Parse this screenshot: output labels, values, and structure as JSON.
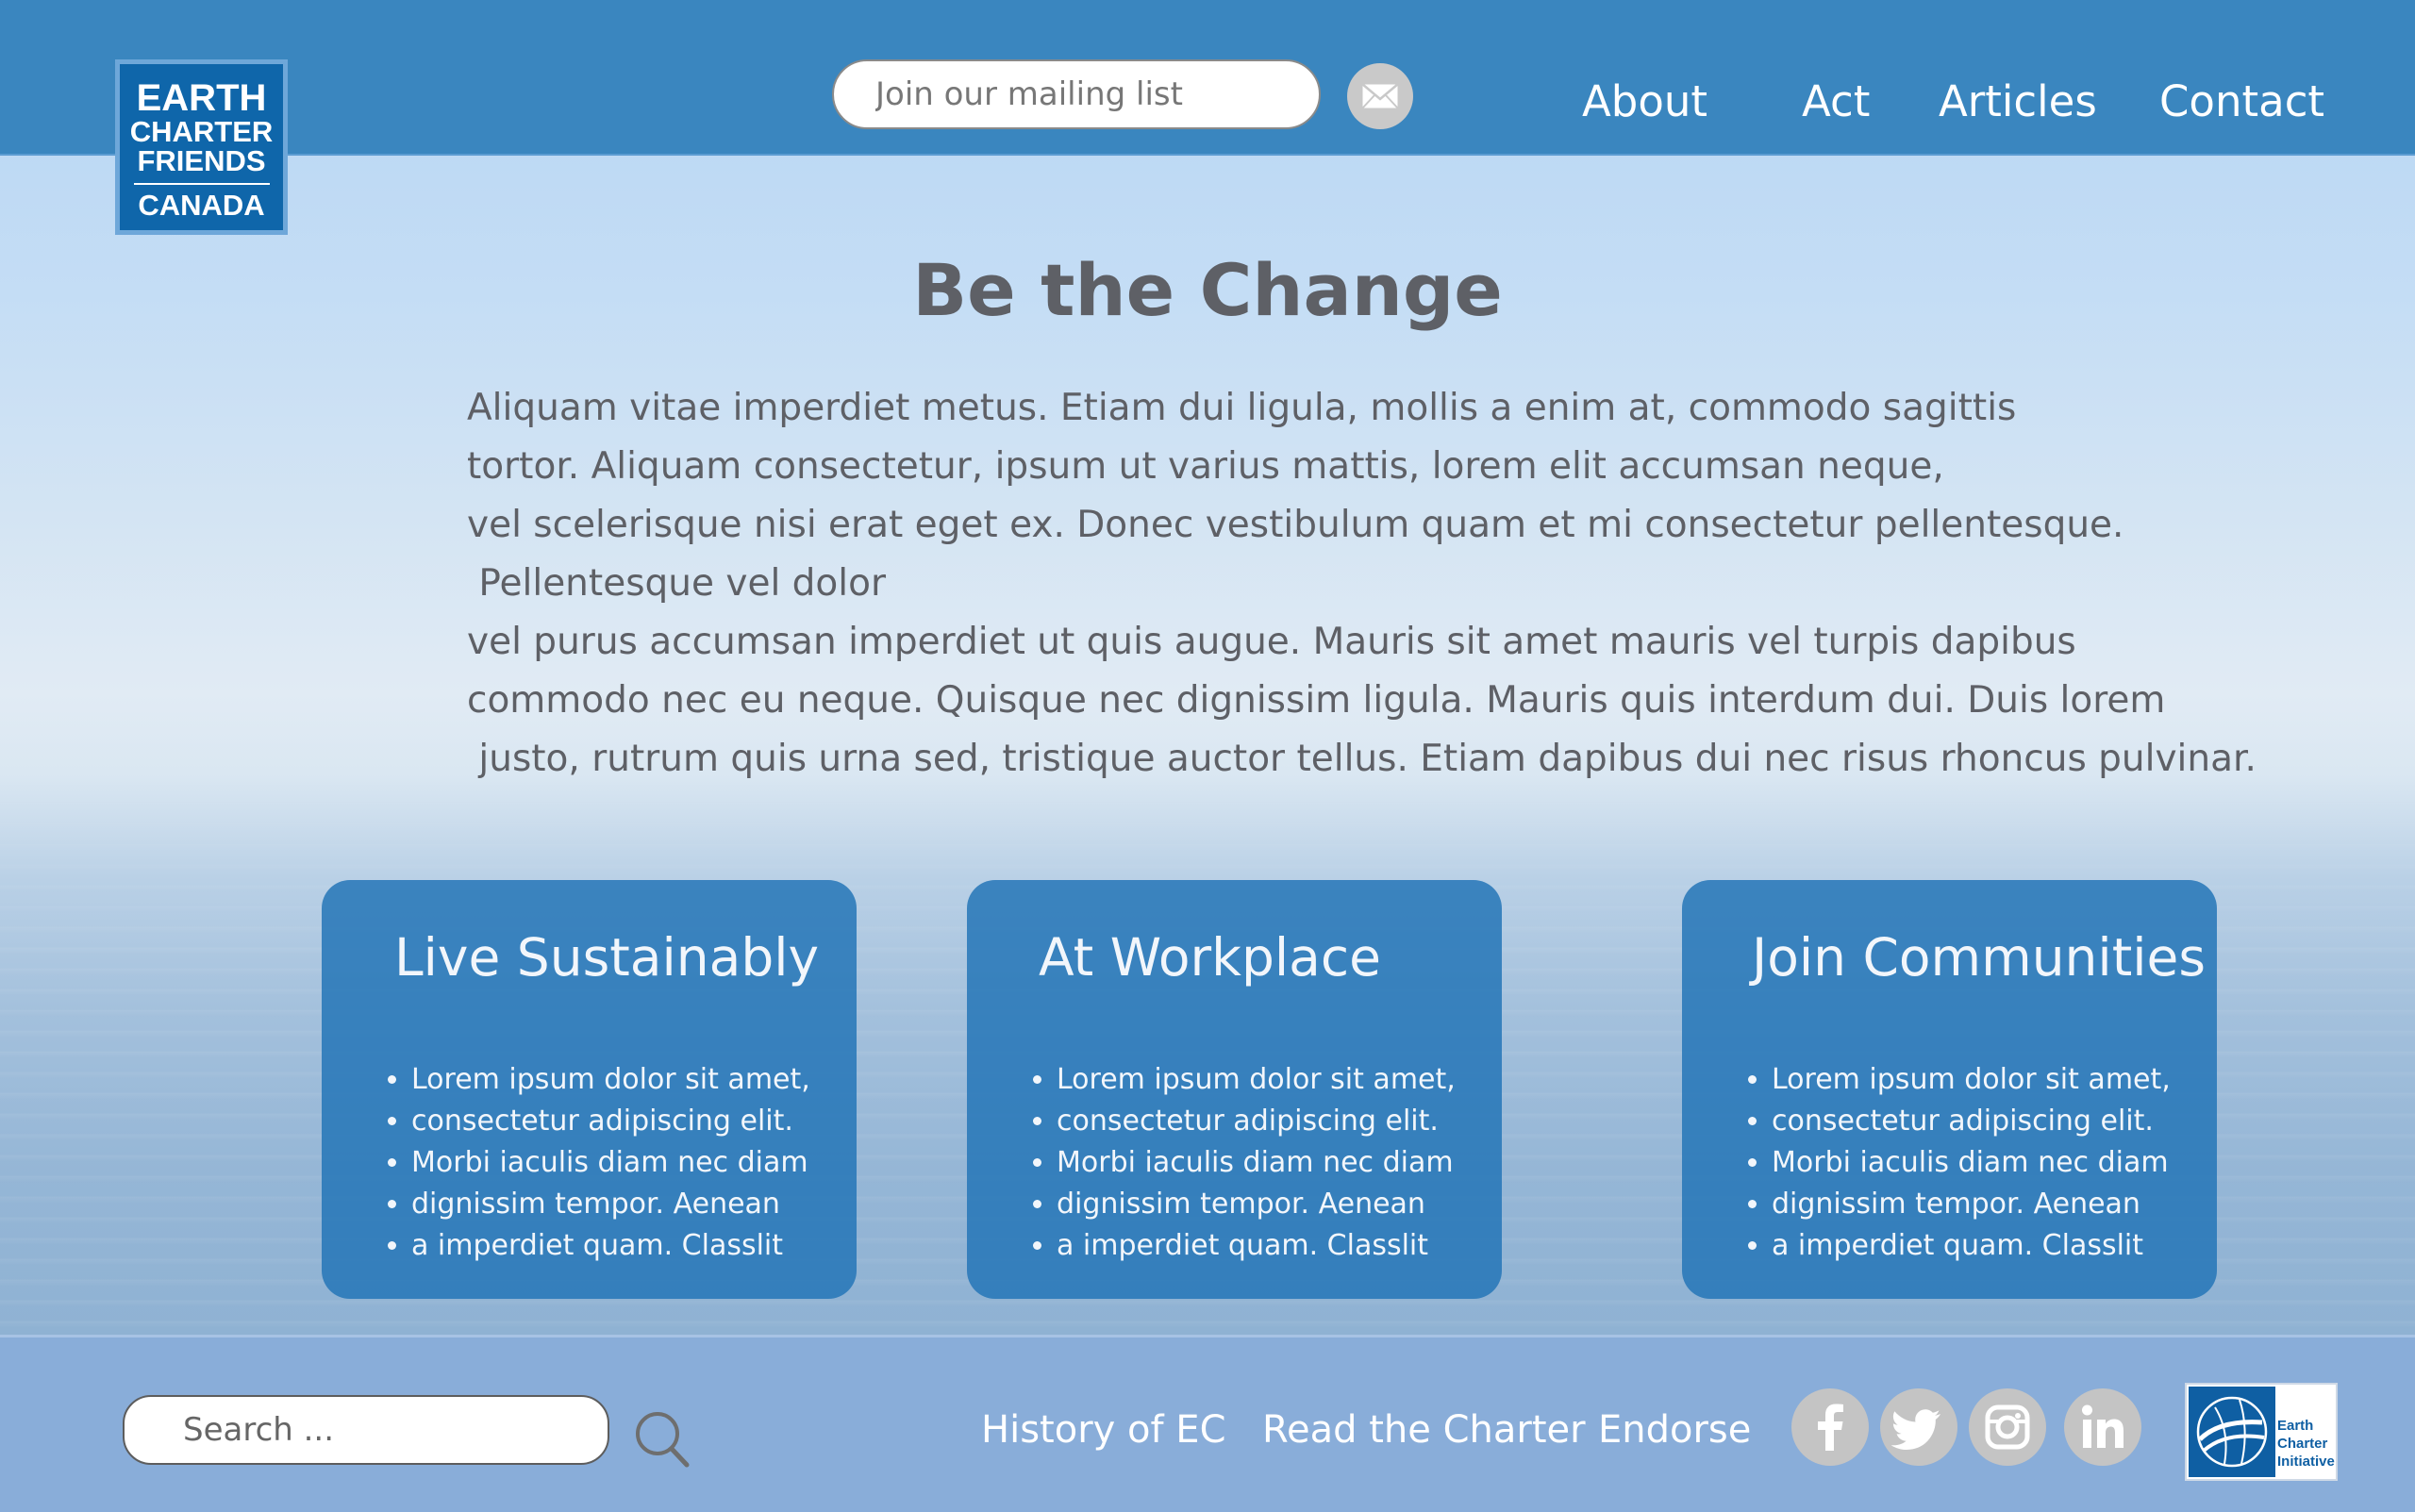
{
  "header": {
    "logo": {
      "line1": "EARTH",
      "line2": "CHARTER",
      "line3": "FRIENDS",
      "line4": "CANADA"
    },
    "mailing_list": {
      "placeholder": "Join our mailing list",
      "icon": "envelope-icon"
    },
    "nav": [
      {
        "label": "About"
      },
      {
        "label": "Act"
      },
      {
        "label": "Articles"
      },
      {
        "label": "Contact"
      }
    ]
  },
  "main": {
    "title": "Be the Change",
    "intro_lines": [
      "Aliquam vitae imperdiet metus. Etiam dui ligula, mollis a enim at, commodo sagittis",
      "tortor. Aliquam consectetur, ipsum ut varius mattis, lorem elit accumsan neque,",
      "vel scelerisque nisi erat eget ex. Donec vestibulum quam et mi consectetur pellentesque.",
      " Pellentesque vel dolor",
      "vel purus accumsan imperdiet ut quis augue. Mauris sit amet mauris vel turpis dapibus",
      "commodo nec eu neque. Quisque nec dignissim ligula. Mauris quis interdum dui. Duis lorem",
      " justo, rutrum quis urna sed, tristique auctor tellus. Etiam dapibus dui nec risus rhoncus pulvinar."
    ],
    "cards": [
      {
        "title": "Live Sustainably",
        "items": [
          "Lorem ipsum dolor sit amet,",
          "consectetur adipiscing elit.",
          "Morbi iaculis diam nec diam",
          "dignissim tempor. Aenean",
          "a imperdiet quam. Classlit"
        ]
      },
      {
        "title": "At Workplace",
        "items": [
          "Lorem ipsum dolor sit amet,",
          "consectetur adipiscing elit.",
          "Morbi iaculis diam nec diam",
          "dignissim tempor. Aenean",
          "a imperdiet quam. Classlit"
        ]
      },
      {
        "title": "Join Communities",
        "items": [
          "Lorem ipsum dolor sit amet,",
          "consectetur adipiscing elit.",
          "Morbi iaculis diam nec diam",
          "dignissim tempor. Aenean",
          "a imperdiet quam. Classlit"
        ]
      }
    ]
  },
  "footer": {
    "search": {
      "placeholder": "Search ...",
      "icon": "search-icon"
    },
    "links": [
      {
        "label": "History of EC"
      },
      {
        "label": "Read the Charter"
      },
      {
        "label": "Endorse"
      }
    ],
    "social": [
      "facebook-icon",
      "twitter-icon",
      "instagram-icon",
      "linkedin-icon"
    ],
    "partner_logo": {
      "line1": "Earth",
      "line2": "Charter",
      "line3": "Initiative"
    }
  },
  "colors": {
    "header_bg": "#3a86bf",
    "footer_bg": "#89add9",
    "card_bg": "#2576b7",
    "text": "#5e6066",
    "social_bg": "#c4c4c4",
    "logo_blue": "#0f66aa"
  }
}
